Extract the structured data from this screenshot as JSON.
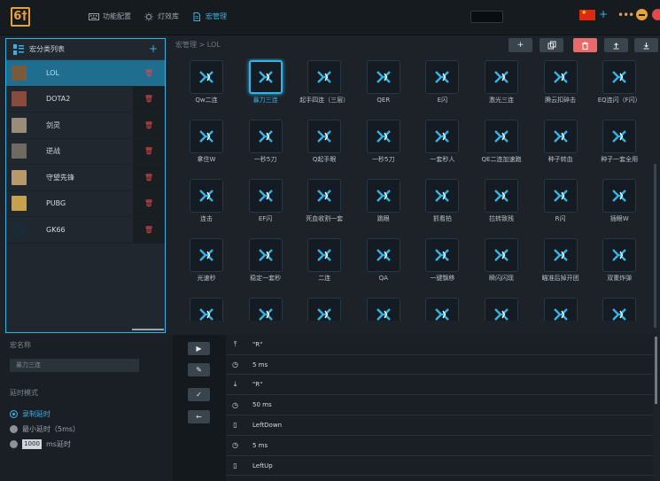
{
  "topnav": {
    "items": [
      {
        "label": "功能配置",
        "icon": "keyboard-icon"
      },
      {
        "label": "灯效库",
        "icon": "sun-icon"
      },
      {
        "label": "宏管理",
        "icon": "document-icon"
      }
    ],
    "logo": "6†"
  },
  "colors": {
    "accent": "#34b3e6",
    "danger": "#e54848",
    "logo": "#e8a23a"
  },
  "macro_list": {
    "title": "宏分类列表",
    "items": [
      {
        "name": "LOL",
        "thumb": "#7a5a3a"
      },
      {
        "name": "DOTA2",
        "thumb": "#8b4a3a"
      },
      {
        "name": "剑灵",
        "thumb": "#9a8c78"
      },
      {
        "name": "逆战",
        "thumb": "#6f6a60"
      },
      {
        "name": "守望先锋",
        "thumb": "#b89a6a"
      },
      {
        "name": "PUBG",
        "thumb": "#c8a24a"
      },
      {
        "name": "GK66",
        "thumb": "#1b2a36"
      }
    ]
  },
  "breadcrumb": "宏管理 > LOL",
  "macros": [
    "Qw二连",
    "暴力三连",
    "起手四连（三层）",
    "QER",
    "E闪",
    "激光三连",
    "腾云扣碎击",
    "EQ连闪（F闪）",
    "拿住W",
    "一秒5刀",
    "Q起手眼",
    "一秒5刀",
    "一套秒人",
    "QE二连加速跑",
    "种子转血",
    "种子一套全用",
    "连击",
    "EF闪",
    "死血收割一套",
    "跳眼",
    "抓看拍",
    "拉转致残",
    "R闪",
    "插眼W",
    "光速秒",
    "稳定一套秒",
    "二连",
    "QA",
    "一键飘移",
    "瞬闪闪现",
    "瞄准后掉开团",
    "双重炸弹",
    "",
    "",
    "",
    "",
    "",
    "",
    "",
    ""
  ],
  "bottom": {
    "name_label": "宏名称",
    "name_value": "暴力三连",
    "delay_label": "延时模式",
    "radio1": "录制延时",
    "radio2": "最小延时（5ms）",
    "radio3_value": "1000",
    "radio3_suffix": "ms延时"
  },
  "events": [
    {
      "icon": "key-up-icon",
      "text": "\"R\""
    },
    {
      "icon": "timer-icon",
      "text": "5 ms"
    },
    {
      "icon": "key-down-icon",
      "text": "\"R\""
    },
    {
      "icon": "timer-icon",
      "text": "50 ms"
    },
    {
      "icon": "mouse-icon",
      "text": "LeftDown"
    },
    {
      "icon": "timer-icon",
      "text": "5 ms"
    },
    {
      "icon": "mouse-icon",
      "text": "LeftUp"
    }
  ]
}
